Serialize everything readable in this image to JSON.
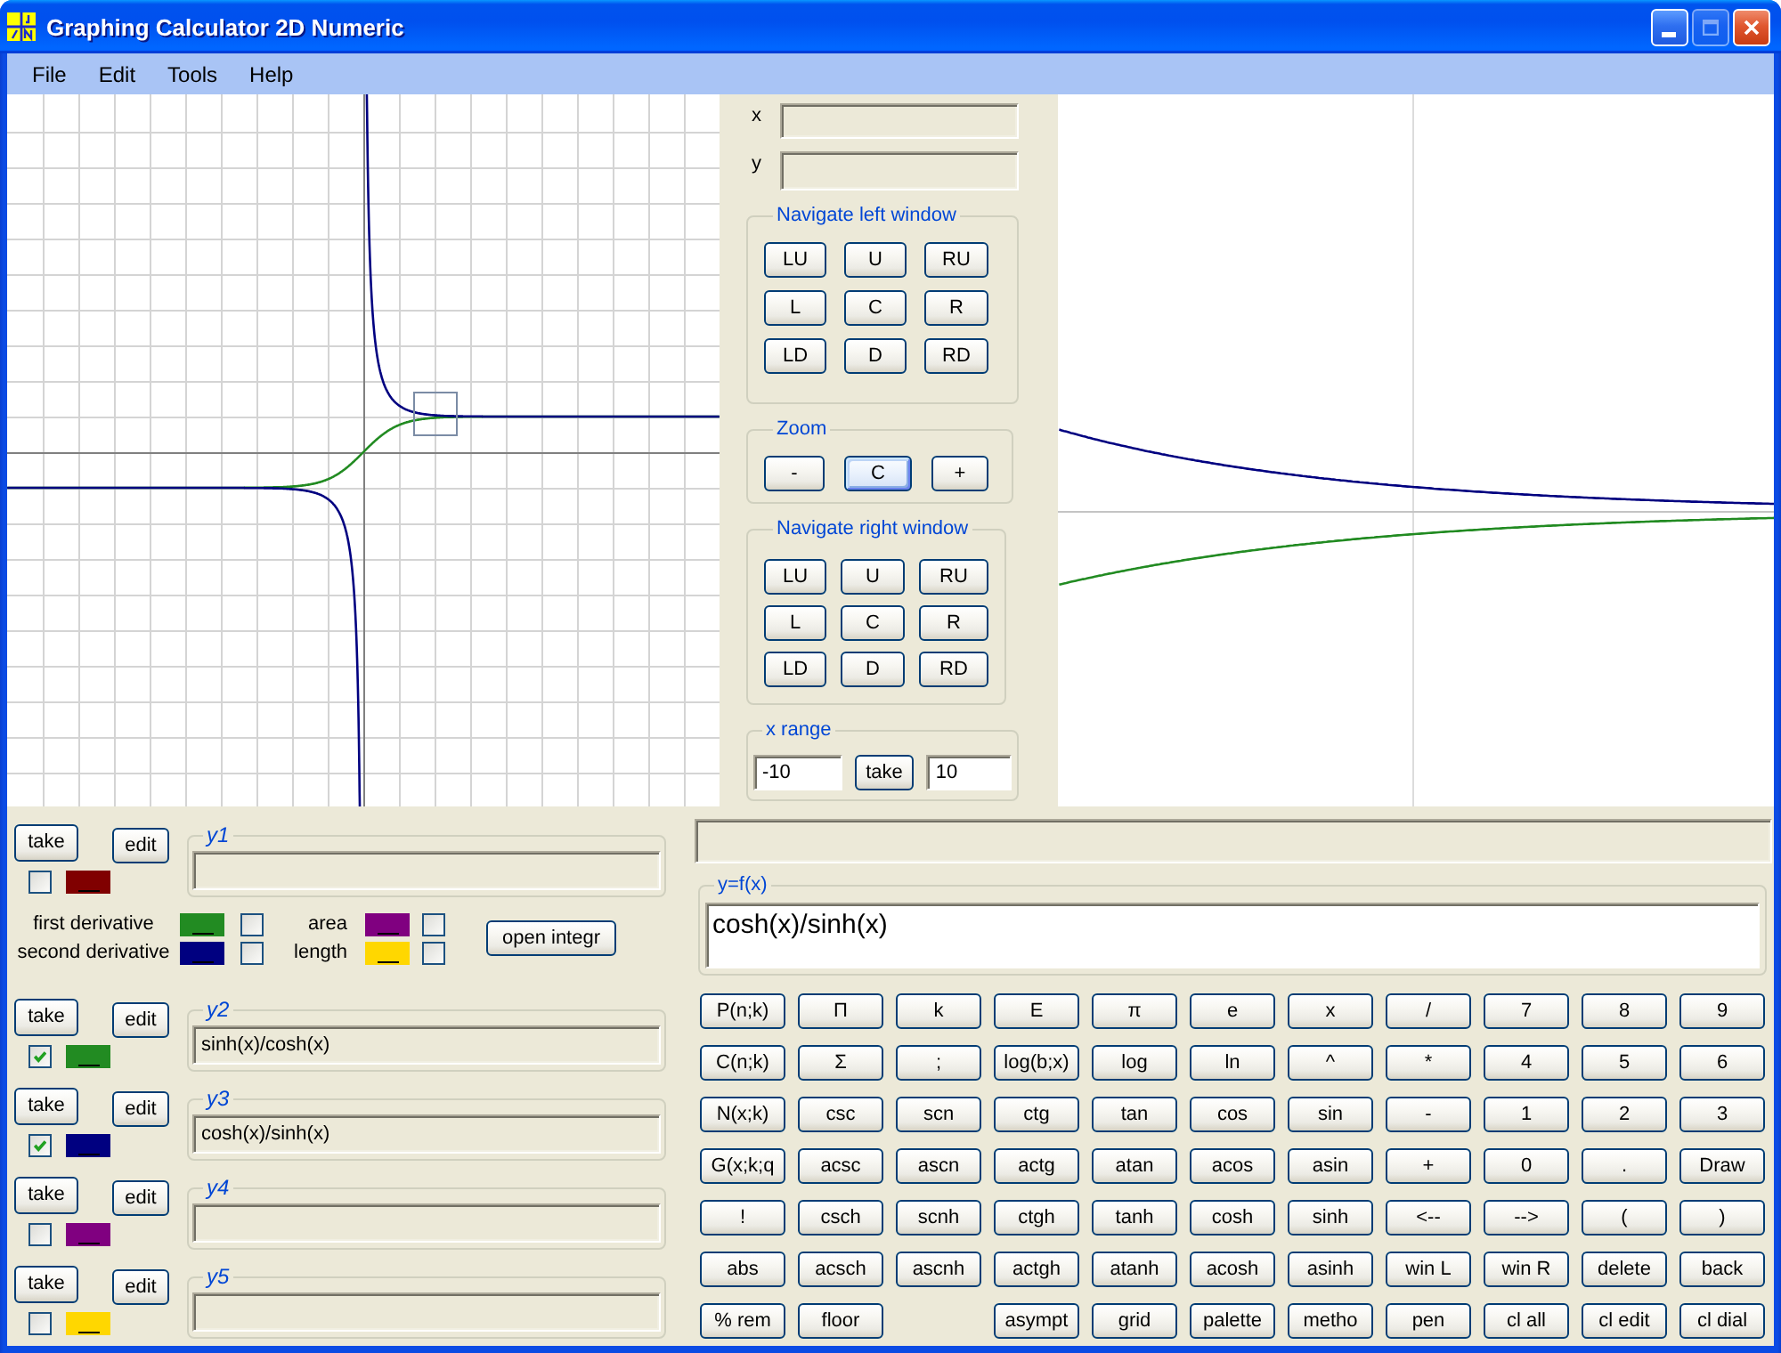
{
  "window": {
    "title": "Graphing Calculator 2D Numeric",
    "buttons": [
      {
        "kind": "minimize",
        "disabled": false
      },
      {
        "kind": "maximize",
        "disabled": true
      },
      {
        "kind": "close",
        "disabled": false
      }
    ]
  },
  "menu": [
    "File",
    "Edit",
    "Tools",
    "Help"
  ],
  "coordinate_fields": [
    {
      "label": "x"
    },
    {
      "label": "y"
    }
  ],
  "navigate_left": {
    "title": "Navigate left window",
    "buttons": [
      "LU",
      "U",
      "RU",
      "L",
      "C",
      "R",
      "LD",
      "D",
      "RD"
    ]
  },
  "zoom": {
    "title": "Zoom",
    "buttons": [
      {
        "label": "-",
        "focused": false
      },
      {
        "label": "C",
        "focused": true
      },
      {
        "label": "+",
        "focused": false
      }
    ]
  },
  "navigate_right": {
    "title": "Navigate right window",
    "buttons": [
      "LU",
      "U",
      "RU",
      "L",
      "C",
      "R",
      "LD",
      "D",
      "RD"
    ]
  },
  "x_range": {
    "title": "x range",
    "from": "-10",
    "button": "take",
    "to": "10"
  },
  "functions": [
    {
      "label": "y1",
      "buttons": [
        "take",
        "edit"
      ],
      "checked": false,
      "color": "#800000"
    },
    {
      "label": "y2",
      "buttons": [
        "take",
        "edit"
      ],
      "checked": true,
      "color": "#228b22",
      "expression": "sinh(x)/cosh(x)"
    },
    {
      "label": "y3",
      "buttons": [
        "take",
        "edit"
      ],
      "checked": true,
      "color": "#000080",
      "expression": "cosh(x)/sinh(x)"
    },
    {
      "label": "y4",
      "buttons": [
        "take",
        "edit"
      ],
      "checked": false,
      "color": "#800080"
    },
    {
      "label": "y5",
      "buttons": [
        "take",
        "edit"
      ],
      "checked": false,
      "color": "#ffd700"
    }
  ],
  "analysis": {
    "derivatives": [
      {
        "label": "first derivative",
        "color": "#228b22",
        "checked": false
      },
      {
        "label": "second derivative",
        "color": "#000080",
        "checked": false
      }
    ],
    "integrals": [
      {
        "label": "area",
        "color": "#800080",
        "checked": false
      },
      {
        "label": "length",
        "color": "#ffd700",
        "checked": false
      }
    ],
    "button": "open integr"
  },
  "expression": {
    "title": "y=f(x)",
    "value": "cosh(x)/sinh(x)"
  },
  "keypad": [
    [
      [
        "P(n;k)",
        "Π",
        "k",
        "E",
        "π",
        "e",
        "x",
        "/",
        "7",
        "8",
        "9"
      ]
    ],
    [
      [
        "C(n;k)",
        "Σ",
        ";",
        "log(b;x)",
        "log",
        "ln",
        "^",
        "*",
        "4",
        "5",
        "6"
      ]
    ],
    [
      [
        "N(x;k)",
        "csc",
        "scn",
        "ctg",
        "tan",
        "cos",
        "sin",
        "-",
        "1",
        "2",
        "3"
      ]
    ],
    [
      [
        "G(x;k;q",
        "acsc",
        "ascn",
        "actg",
        "atan",
        "acos",
        "asin",
        "+",
        "0",
        ".",
        "Draw"
      ]
    ],
    [
      [
        "!",
        "csch",
        "scnh",
        "ctgh",
        "tanh",
        "cosh",
        "sinh",
        "<--",
        "-->",
        "(",
        ")"
      ]
    ],
    [
      [
        "abs",
        "acsch",
        "ascnh",
        "actgh",
        "atanh",
        "acosh",
        "asinh",
        "win L",
        "win R",
        "delete",
        "back"
      ]
    ],
    [
      [
        "% rem",
        "floor"
      ],
      [
        "asympt",
        "grid",
        "palette",
        "metho",
        "pen",
        "cl all",
        "cl edit",
        "cl dial"
      ]
    ]
  ]
}
